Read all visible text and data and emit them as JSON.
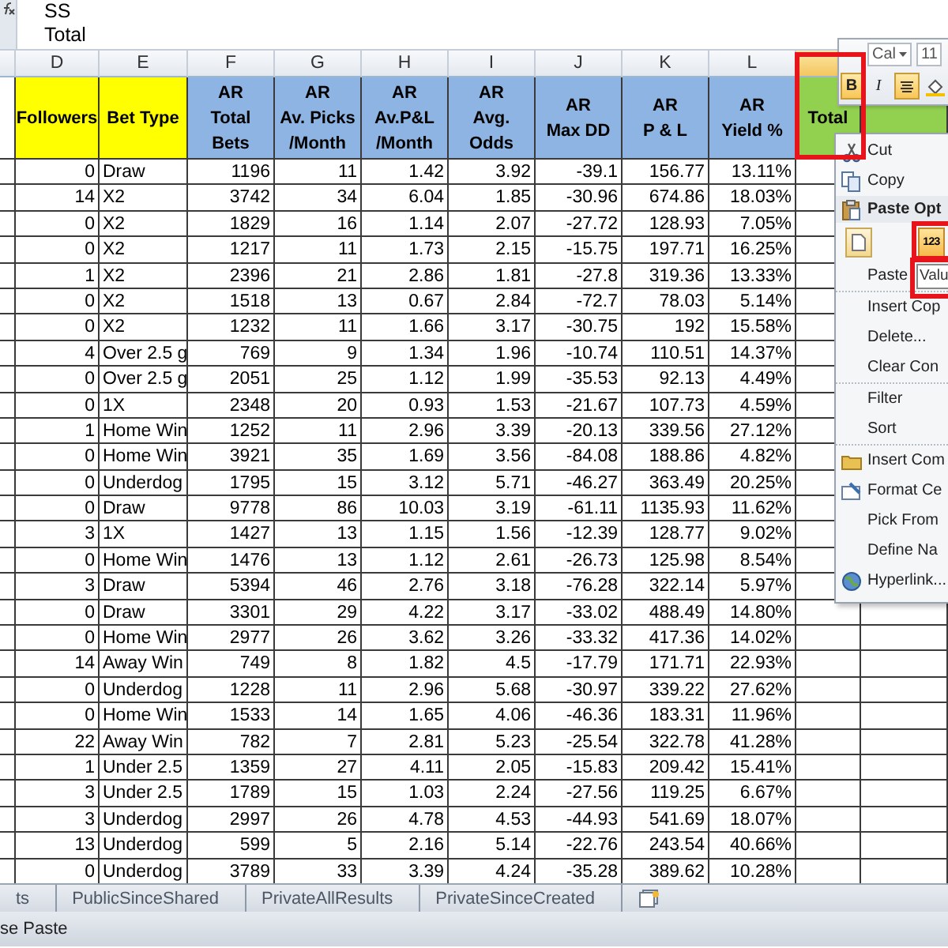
{
  "formula_bar": {
    "lines": [
      "SS",
      "Total"
    ]
  },
  "column_headers": [
    {
      "letter": "D",
      "selected": false
    },
    {
      "letter": "E",
      "selected": false
    },
    {
      "letter": "F",
      "selected": false
    },
    {
      "letter": "G",
      "selected": false
    },
    {
      "letter": "H",
      "selected": false
    },
    {
      "letter": "I",
      "selected": false
    },
    {
      "letter": "J",
      "selected": false
    },
    {
      "letter": "K",
      "selected": false
    },
    {
      "letter": "L",
      "selected": false
    },
    {
      "selected": true
    }
  ],
  "header_row": [
    {
      "label": "Followers",
      "color": "#ffff00"
    },
    {
      "label": "Bet Type",
      "color": "#ffff00"
    },
    {
      "label": "AR\nTotal\nBets",
      "color": "#8db4e2"
    },
    {
      "label": "AR\nAv. Picks\n/Month",
      "color": "#8db4e2"
    },
    {
      "label": "AR\nAv.P&L\n/Month",
      "color": "#8db4e2"
    },
    {
      "label": "AR\nAvg.\nOdds",
      "color": "#8db4e2"
    },
    {
      "label": "AR\nMax DD",
      "color": "#8db4e2"
    },
    {
      "label": "AR\nP & L",
      "color": "#8db4e2"
    },
    {
      "label": "AR\nYield %",
      "color": "#8db4e2"
    },
    {
      "label": "Total",
      "color": "#92d050"
    },
    {
      "color": "#92d050"
    }
  ],
  "rows": [
    [
      "0",
      "Draw",
      "1196",
      "11",
      "1.42",
      "3.92",
      "-39.1",
      "156.77",
      "13.11%"
    ],
    [
      "14",
      "X2",
      "3742",
      "34",
      "6.04",
      "1.85",
      "-30.96",
      "674.86",
      "18.03%"
    ],
    [
      "0",
      "X2",
      "1829",
      "16",
      "1.14",
      "2.07",
      "-27.72",
      "128.93",
      "7.05%"
    ],
    [
      "0",
      "X2",
      "1217",
      "11",
      "1.73",
      "2.15",
      "-15.75",
      "197.71",
      "16.25%"
    ],
    [
      "1",
      "X2",
      "2396",
      "21",
      "2.86",
      "1.81",
      "-27.8",
      "319.36",
      "13.33%"
    ],
    [
      "0",
      "X2",
      "1518",
      "13",
      "0.67",
      "2.84",
      "-72.7",
      "78.03",
      "5.14%"
    ],
    [
      "0",
      "X2",
      "1232",
      "11",
      "1.66",
      "3.17",
      "-30.75",
      "192",
      "15.58%"
    ],
    [
      "4",
      "Over 2.5 g",
      "769",
      "9",
      "1.34",
      "1.96",
      "-10.74",
      "110.51",
      "14.37%"
    ],
    [
      "0",
      "Over 2.5 g",
      "2051",
      "25",
      "1.12",
      "1.99",
      "-35.53",
      "92.13",
      "4.49%"
    ],
    [
      "0",
      "1X",
      "2348",
      "20",
      "0.93",
      "1.53",
      "-21.67",
      "107.73",
      "4.59%"
    ],
    [
      "1",
      "Home Win",
      "1252",
      "11",
      "2.96",
      "3.39",
      "-20.13",
      "339.56",
      "27.12%"
    ],
    [
      "0",
      "Home Win",
      "3921",
      "35",
      "1.69",
      "3.56",
      "-84.08",
      "188.86",
      "4.82%"
    ],
    [
      "0",
      "Underdog",
      "1795",
      "15",
      "3.12",
      "5.71",
      "-46.27",
      "363.49",
      "20.25%"
    ],
    [
      "0",
      "Draw",
      "9778",
      "86",
      "10.03",
      "3.19",
      "-61.11",
      "1135.93",
      "11.62%"
    ],
    [
      "3",
      "1X",
      "1427",
      "13",
      "1.15",
      "1.56",
      "-12.39",
      "128.77",
      "9.02%"
    ],
    [
      "0",
      "Home Win",
      "1476",
      "13",
      "1.12",
      "2.61",
      "-26.73",
      "125.98",
      "8.54%"
    ],
    [
      "3",
      "Draw",
      "5394",
      "46",
      "2.76",
      "3.18",
      "-76.28",
      "322.14",
      "5.97%"
    ],
    [
      "0",
      "Draw",
      "3301",
      "29",
      "4.22",
      "3.17",
      "-33.02",
      "488.49",
      "14.80%"
    ],
    [
      "0",
      "Home Win",
      "2977",
      "26",
      "3.62",
      "3.26",
      "-33.32",
      "417.36",
      "14.02%"
    ],
    [
      "14",
      "Away Win",
      "749",
      "8",
      "1.82",
      "4.5",
      "-17.79",
      "171.71",
      "22.93%"
    ],
    [
      "0",
      "Underdog",
      "1228",
      "11",
      "2.96",
      "5.68",
      "-30.97",
      "339.22",
      "27.62%"
    ],
    [
      "0",
      "Home Win",
      "1533",
      "14",
      "1.65",
      "4.06",
      "-46.36",
      "183.31",
      "11.96%"
    ],
    [
      "22",
      "Away Win",
      "782",
      "7",
      "2.81",
      "5.23",
      "-25.54",
      "322.78",
      "41.28%"
    ],
    [
      "1",
      "Under 2.5",
      "1359",
      "27",
      "4.11",
      "2.05",
      "-15.83",
      "209.42",
      "15.41%"
    ],
    [
      "3",
      "Under 2.5",
      "1789",
      "15",
      "1.03",
      "2.24",
      "-27.56",
      "119.25",
      "6.67%"
    ],
    [
      "3",
      "Underdog",
      "2997",
      "26",
      "4.78",
      "4.53",
      "-44.93",
      "541.69",
      "18.07%"
    ],
    [
      "13",
      "Underdog",
      "599",
      "5",
      "2.16",
      "5.14",
      "-22.76",
      "243.54",
      "40.66%"
    ],
    [
      "0",
      "Underdog",
      "3789",
      "33",
      "3.39",
      "4.24",
      "-35.28",
      "389.62",
      "10.28%"
    ]
  ],
  "mini_toolbar": {
    "font": "Cal",
    "size": "11",
    "buttons": [
      {
        "kind": "bold",
        "label": "B",
        "on": true
      },
      {
        "kind": "italic",
        "label": "I",
        "on": false
      },
      {
        "kind": "align",
        "on": true
      },
      {
        "kind": "fill",
        "on": false
      }
    ]
  },
  "context_menu": {
    "items": [
      {
        "kind": "item",
        "label": "Cut"
      },
      {
        "kind": "item",
        "label": "Copy"
      },
      {
        "kind": "header",
        "label": "Paste Opt"
      },
      {
        "kind": "paste_options",
        "options": [
          {
            "selected": false
          },
          {
            "label": "123",
            "selected": true
          }
        ]
      },
      {
        "kind": "item",
        "label": "Paste"
      },
      {
        "kind": "item",
        "label": "Insert Cop"
      },
      {
        "kind": "item",
        "label": "Delete..."
      },
      {
        "kind": "item",
        "label": "Clear Con"
      },
      {
        "kind": "item",
        "label": "Filter"
      },
      {
        "kind": "item",
        "label": "Sort"
      },
      {
        "kind": "item",
        "label": "Insert Com"
      },
      {
        "kind": "item",
        "label": "Format Ce"
      },
      {
        "kind": "item",
        "label": "Pick From"
      },
      {
        "kind": "item",
        "label": "Define Na"
      },
      {
        "kind": "item",
        "label": "Hyperlink..."
      }
    ],
    "tooltip": "Valu"
  },
  "sheet_tabs": [
    {
      "label": "ts",
      "selected": false
    },
    {
      "label": "PublicSinceShared",
      "selected": false
    },
    {
      "label": "PrivateAllResults",
      "selected": false
    },
    {
      "label": "PrivateSinceCreated",
      "selected": false
    }
  ],
  "status_bar": {
    "text": "se Paste"
  }
}
